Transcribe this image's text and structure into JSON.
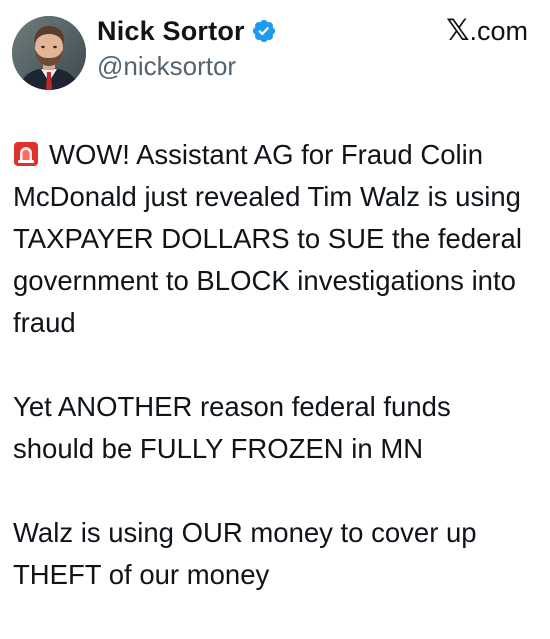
{
  "author": {
    "display_name": "Nick Sortor",
    "handle": "@nicksortor",
    "verified": true,
    "verified_icon": "verified-badge-icon",
    "avatar_icon": "avatar"
  },
  "source": {
    "label": ".com",
    "logo_glyph": "𝕏"
  },
  "tweet": {
    "lead_icon": "siren-icon",
    "paragraphs": [
      "WOW! Assistant AG for Fraud Colin McDonald just revealed Tim Walz is using TAXPAYER DOLLARS to SUE the federal government to BLOCK investigations into fraud",
      "Yet ANOTHER reason federal funds should be FULLY FROZEN in MN",
      "Walz is using OUR money to cover up THEFT of our money"
    ]
  },
  "colors": {
    "text": "#0f1419",
    "secondary_text": "#536471",
    "verified_blue": "#1d9bf0",
    "siren_red": "#e0322c"
  }
}
